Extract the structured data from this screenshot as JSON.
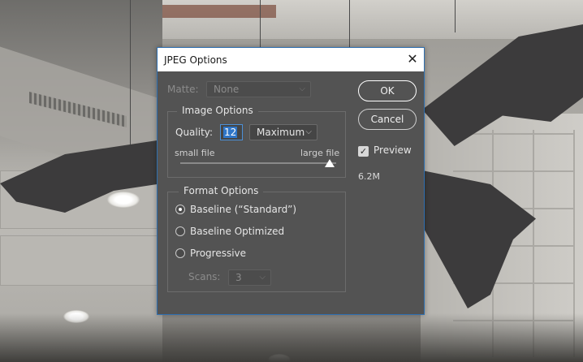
{
  "dialog": {
    "title": "JPEG Options",
    "close_icon": "close-icon",
    "matte": {
      "label": "Matte:",
      "value": "None"
    },
    "image_options": {
      "title": "Image Options",
      "quality_label": "Quality:",
      "quality_value": "12",
      "quality_preset": "Maximum",
      "slider_min_label": "small file",
      "slider_max_label": "large file",
      "slider_level_fraction": 1.0
    },
    "format_options": {
      "title": "Format Options",
      "options": [
        {
          "label": "Baseline (“Standard”)",
          "selected": true
        },
        {
          "label": "Baseline Optimized",
          "selected": false
        },
        {
          "label": "Progressive",
          "selected": false
        }
      ],
      "scans_label": "Scans:",
      "scans_value": "3"
    },
    "ok_label": "OK",
    "cancel_label": "Cancel",
    "preview_label": "Preview",
    "preview_checked": true,
    "file_size": "6.2M"
  }
}
